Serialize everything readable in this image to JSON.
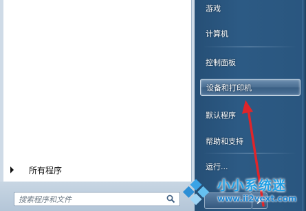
{
  "start_menu": {
    "right_items": [
      {
        "label": "游戏"
      },
      {
        "label": "计算机"
      },
      {
        "label": "控制面板"
      },
      {
        "label": "设备和打印机"
      },
      {
        "label": "默认程序"
      },
      {
        "label": "帮助和支持"
      },
      {
        "label": "运行..."
      }
    ],
    "highlighted_item": "设备和打印机",
    "all_programs_label": "所有程序",
    "search": {
      "placeholder": "搜索程序和文件",
      "icon": "search-icon"
    },
    "shutdown_icon": "power-icon"
  },
  "watermark": {
    "title": "小小系统迷",
    "url": "www.ii2vext.com"
  },
  "colors": {
    "right_panel": "#2c5a84",
    "highlight": "#4b6f93",
    "annotation_arrow": "#e0252a",
    "watermark": "#1fa0e6"
  }
}
